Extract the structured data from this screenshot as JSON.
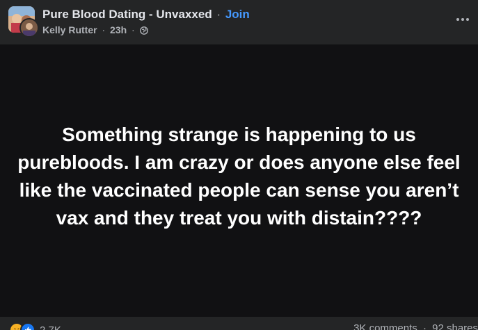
{
  "header": {
    "group_name": "Pure Blood Dating - Unvaxxed",
    "separator": "·",
    "join_label": "Join",
    "author": "Kelly Rutter",
    "time": "23h",
    "privacy_icon": "globe-icon",
    "more_icon": "more-options-icon"
  },
  "post": {
    "text": "Something strange is happening to us purebloods. I am crazy or does anyone else feel like the vaccinated people can sense you aren’t vax and they treat you with distain????"
  },
  "footer": {
    "reactions": [
      "haha-reaction-icon",
      "like-reaction-icon"
    ],
    "reaction_count": "2.7K",
    "comments": "3K comments",
    "shares": "92 shares"
  },
  "colors": {
    "card_bg": "#242526",
    "content_bg": "#111113",
    "text_primary": "#e4e6eb",
    "text_secondary": "#b0b3b8",
    "link_blue": "#4599ff"
  }
}
